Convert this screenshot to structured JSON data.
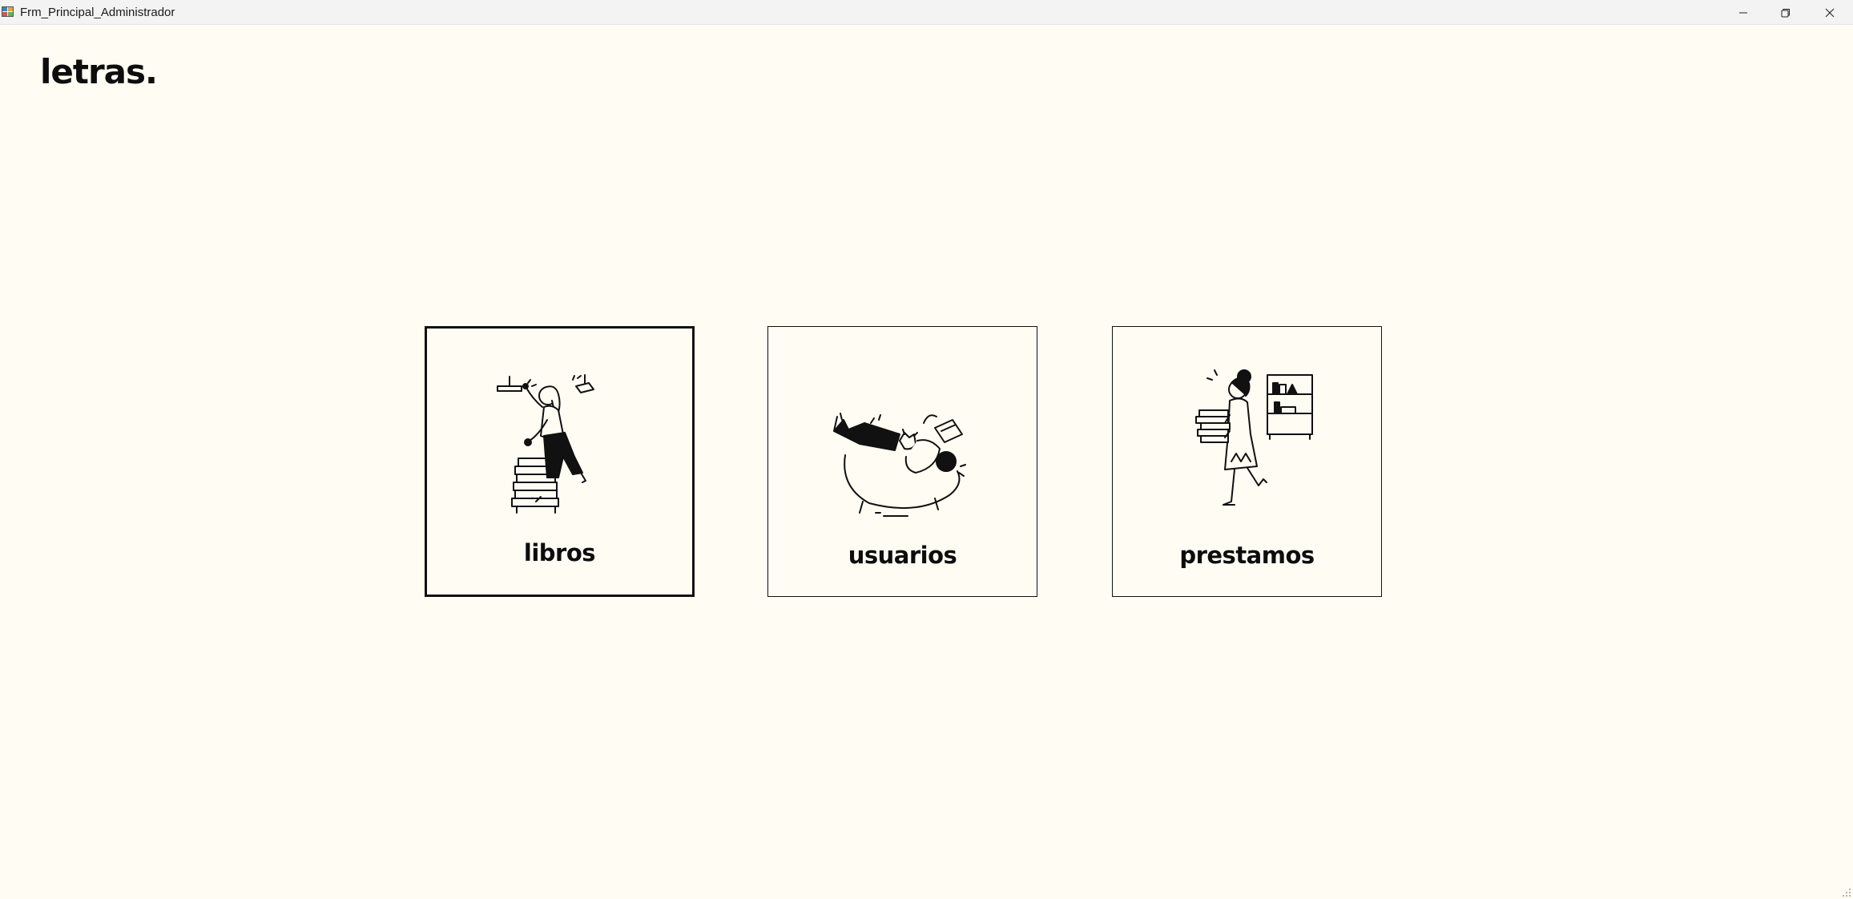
{
  "window": {
    "title": "Frm_Principal_Administrador"
  },
  "header": {
    "logo_text": "letras."
  },
  "cards": [
    {
      "label": "libros",
      "icon": "person-stacking-books-illustration",
      "selected": true
    },
    {
      "label": "usuarios",
      "icon": "people-reading-on-sofa-illustration",
      "selected": false
    },
    {
      "label": "prestamos",
      "icon": "woman-carrying-books-illustration",
      "selected": false
    }
  ],
  "colors": {
    "background": "#fefcf3",
    "titlebar": "#f3f3f3",
    "border": "#111111",
    "text": "#0d0d0d"
  }
}
